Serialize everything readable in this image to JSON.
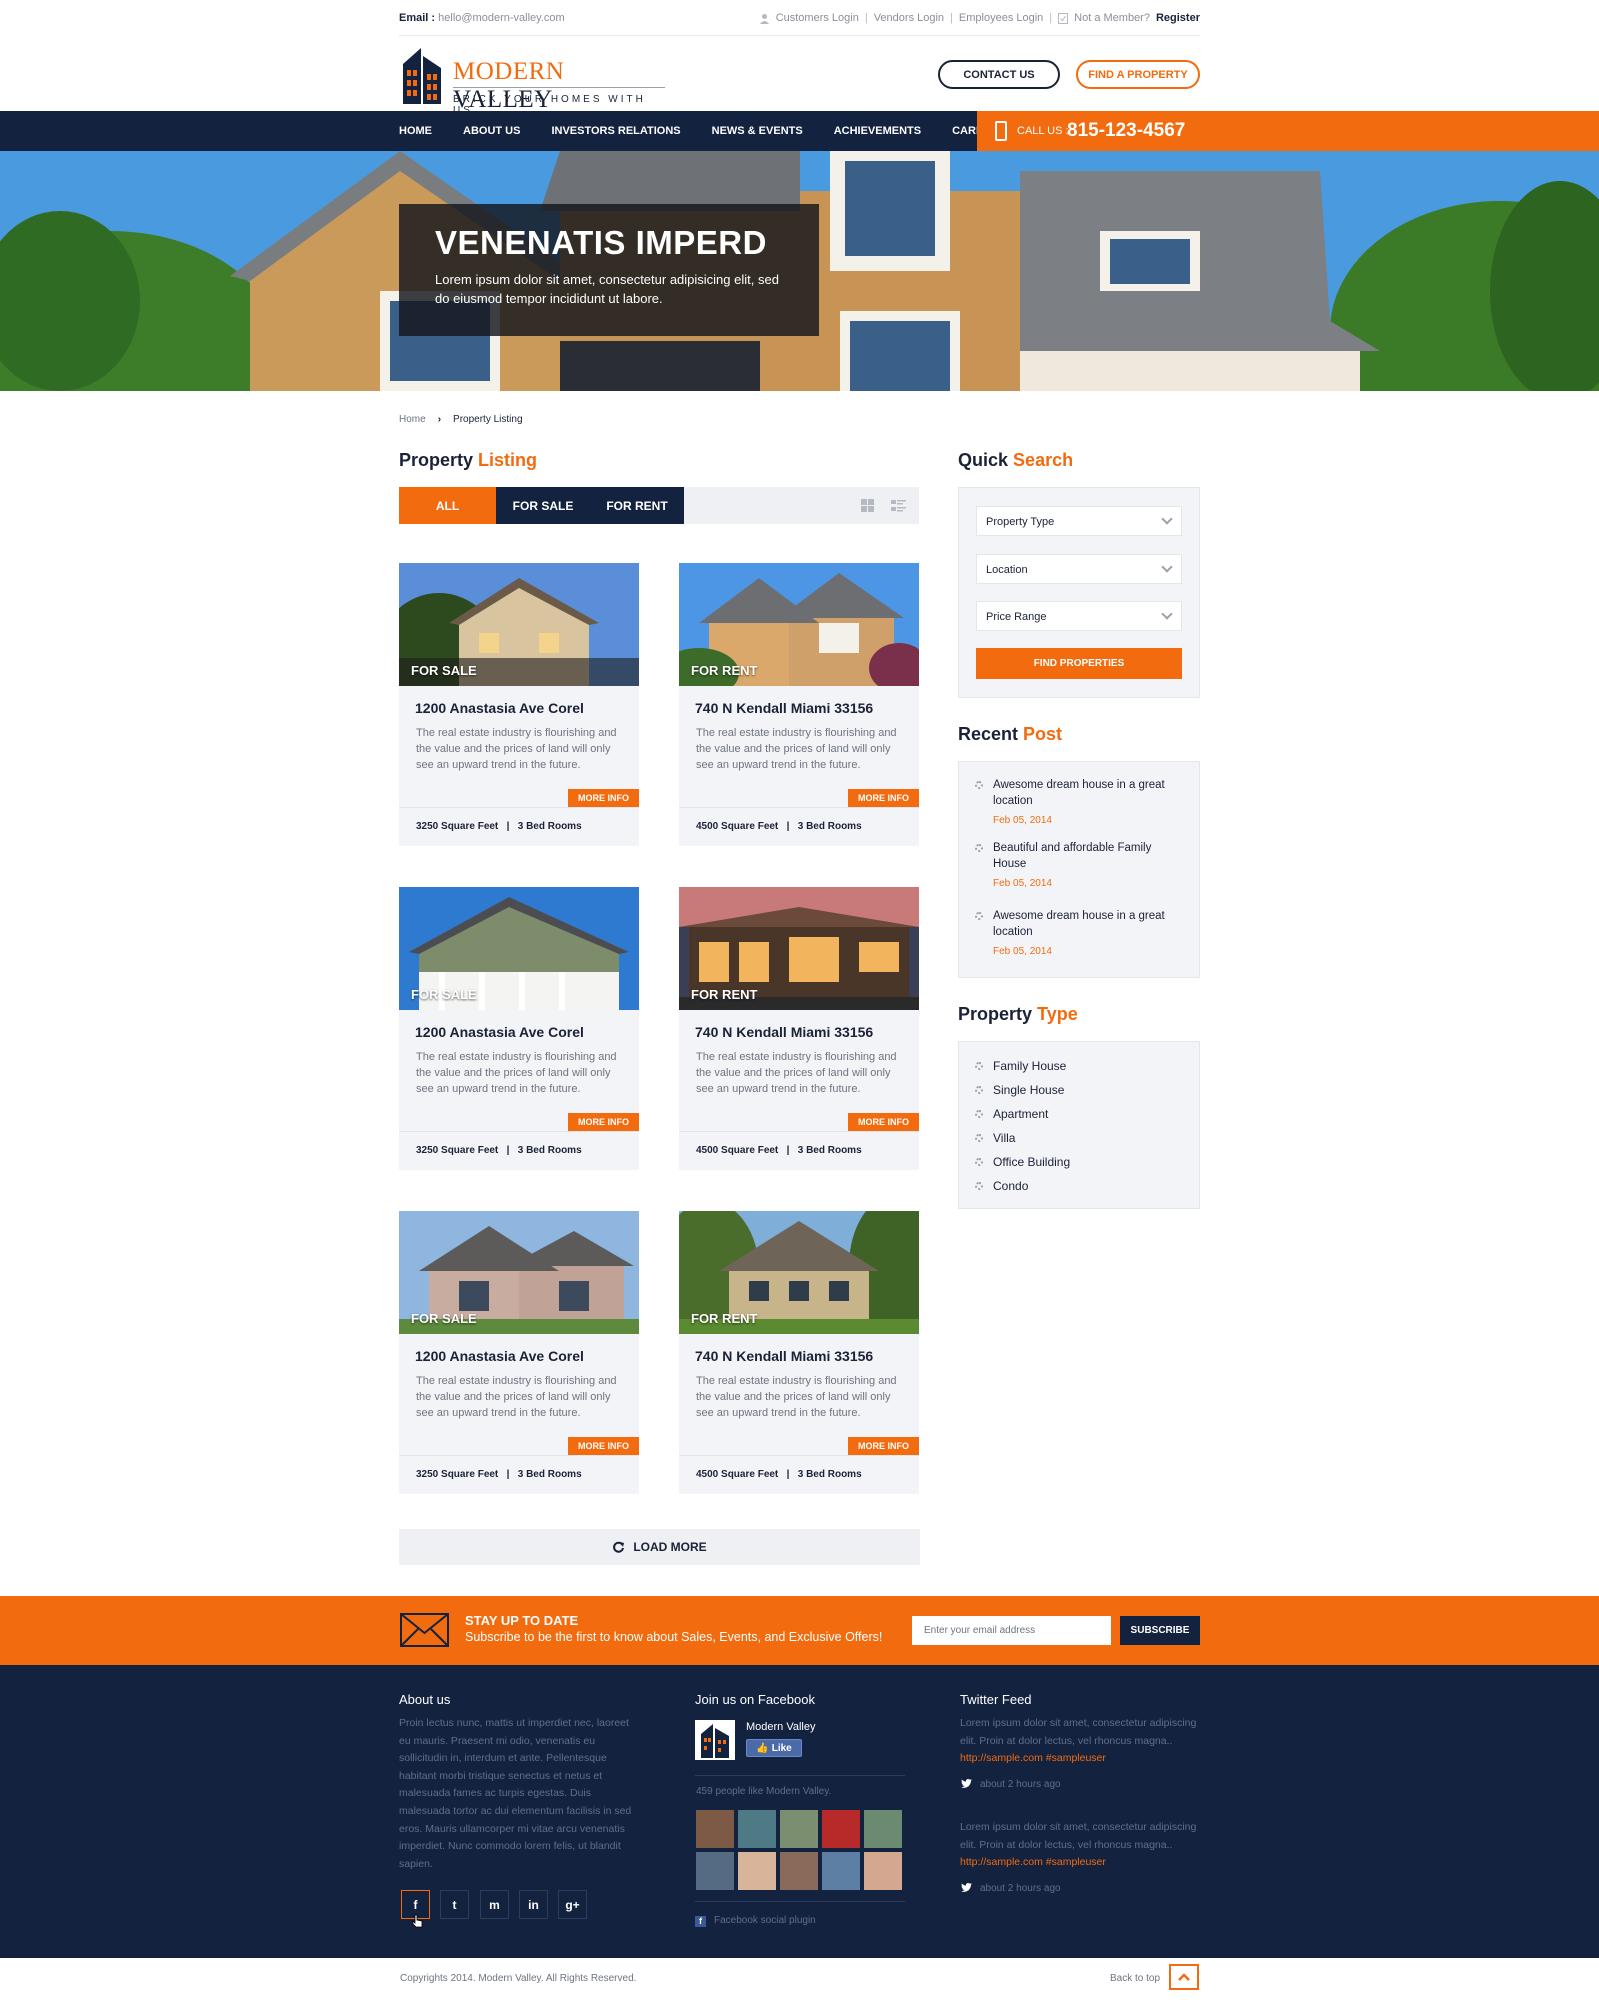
{
  "topbar": {
    "email_label": "Email :",
    "email": "hello@modern-valley.com",
    "customers_login": "Customers Login",
    "vendors_login": "Vendors Login",
    "employees_login": "Employees Login",
    "not_member": "Not a Member?",
    "register": "Register"
  },
  "brand": {
    "name_first": "MODERN",
    "name_second": "VALLEY",
    "tagline": "BRICK YOUR HOMES WITH US"
  },
  "header": {
    "contact_label": "CONTACT US",
    "find_label": "FIND A PROPERTY"
  },
  "nav": {
    "items": [
      "HOME",
      "ABOUT US",
      "INVESTORS RELATIONS",
      "NEWS & EVENTS",
      "ACHIEVEMENTS",
      "CAREERS"
    ],
    "call_label": "CALL US :",
    "phone": "815-123-4567"
  },
  "hero": {
    "title": "VENENATIS IMPERD",
    "text": "Lorem ipsum dolor sit amet, consectetur adipisicing elit, sed do eiusmod tempor incididunt ut labore."
  },
  "breadcrumb": {
    "home": "Home",
    "separator": "›",
    "current": "Property Listing"
  },
  "listing": {
    "heading_a": "Property",
    "heading_b": "Listing",
    "tabs": [
      "ALL",
      "FOR SALE",
      "FOR RENT"
    ],
    "more_label": "MORE INFO",
    "load_more": "LOAD MORE",
    "cards": [
      {
        "badge": "FOR SALE",
        "title": "1200 Anastasia Ave Corel",
        "desc": "The real estate industry is flourishing and the value and the prices of land will only see an upward trend in the future.",
        "area": "3250 Square Feet",
        "rooms": "3 Bed Rooms"
      },
      {
        "badge": "FOR RENT",
        "title": "740 N Kendall Miami 33156",
        "desc": "The real estate industry is flourishing and the value and the prices of land will only see an upward trend in the future.",
        "area": "4500 Square Feet",
        "rooms": "3 Bed Rooms"
      },
      {
        "badge": "FOR SALE",
        "title": "1200 Anastasia Ave Corel",
        "desc": "The real estate industry is flourishing and the value and the prices of land will only see an upward trend in the future.",
        "area": "3250 Square Feet",
        "rooms": "3 Bed Rooms"
      },
      {
        "badge": "FOR RENT",
        "title": "740 N Kendall Miami 33156",
        "desc": "The real estate industry is flourishing and the value and the prices of land will only see an upward trend in the future.",
        "area": "4500 Square Feet",
        "rooms": "3 Bed Rooms"
      },
      {
        "badge": "FOR SALE",
        "title": "1200 Anastasia Ave Corel",
        "desc": "The real estate industry is flourishing and the value and the prices of land will only see an upward trend in the future.",
        "area": "3250 Square Feet",
        "rooms": "3 Bed Rooms"
      },
      {
        "badge": "FOR RENT",
        "title": "740 N Kendall Miami 33156",
        "desc": "The real estate industry is flourishing and the value and the prices of land will only see an upward trend in the future.",
        "area": "4500 Square Feet",
        "rooms": "3 Bed Rooms"
      }
    ]
  },
  "quick_search": {
    "heading_a": "Quick",
    "heading_b": "Search",
    "selects": [
      "Property Type",
      "Location",
      "Price Range"
    ],
    "button": "FIND PROPERTIES"
  },
  "recent_post": {
    "heading_a": "Recent",
    "heading_b": "Post",
    "posts": [
      {
        "title": "Awesome dream house in a great location",
        "date": "Feb 05, 2014"
      },
      {
        "title": "Beautiful and affordable Family House",
        "date": "Feb 05, 2014"
      },
      {
        "title": "Awesome dream house in a great location",
        "date": "Feb 05, 2014"
      }
    ]
  },
  "property_type": {
    "heading_a": "Property",
    "heading_b": "Type",
    "items": [
      "Family House",
      "Single House",
      "Apartment",
      "Villa",
      "Office Building",
      "Condo"
    ]
  },
  "newsletter": {
    "title": "STAY UP TO DATE",
    "text": "Subscribe to be the first to know about Sales, Events, and Exclusive Offers!",
    "placeholder": "Enter your email address",
    "button": "SUBSCRIBE"
  },
  "footer": {
    "about_title": "About us",
    "about_text": "Proin lectus nunc, mattis ut imperdiet nec, laoreet eu mauris. Praesent mi odio, venenatis eu sollicitudin in, interdum et ante. Pellentesque habitant morbi tristique senectus et netus et malesuada fames ac turpis egestas. Duis malesuada tortor ac dui elementum facilisis in sed eros. Mauris ullamcorper mi vitae arcu venenatis imperdiet. Nunc commodo lorem felis, ut blandit sapien.",
    "social": [
      "f",
      "t",
      "m",
      "in",
      "g+"
    ],
    "fb_title": "Join us on Facebook",
    "fb_page": "Modern Valley",
    "fb_like": "Like",
    "fb_count": "459 people like Modern Valley.",
    "fb_plugin": "Facebook social plugin",
    "twitter_title": "Twitter Feed",
    "tweets": [
      {
        "text": "Lorem ipsum dolor sit amet, consectetur adipiscing elit. Proin at dolor lectus, vel rhoncus magna..",
        "link": "http://sample.com #sampleuser",
        "time": "about 2 hours ago"
      },
      {
        "text": "Lorem ipsum dolor sit amet, consectetur adipiscing elit. Proin at dolor lectus, vel rhoncus magna..",
        "link": "http://sample.com #sampleuser",
        "time": "about 2 hours ago"
      }
    ]
  },
  "copyright": {
    "text": "Copyrights 2014. Modern Valley. All Rights Reserved.",
    "back_to_top": "Back to top"
  },
  "colors": {
    "accent": "#f26b0f",
    "navy": "#13223f",
    "panel": "#f3f4f7"
  }
}
